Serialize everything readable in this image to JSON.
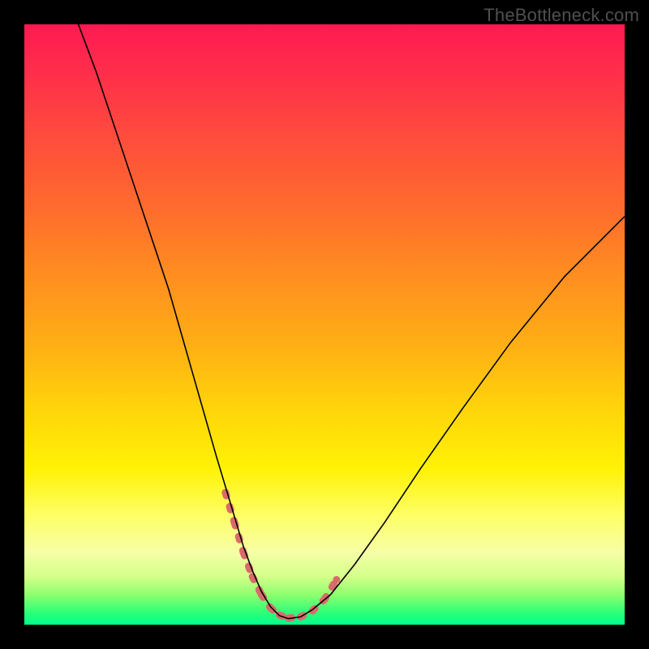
{
  "watermark": "TheBottleneck.com",
  "chart_data": {
    "type": "line",
    "title": "",
    "xlabel": "",
    "ylabel": "",
    "xlim": [
      0,
      100
    ],
    "ylim": [
      0,
      100
    ],
    "grid": false,
    "series": [
      {
        "name": "bottleneck-curve",
        "x": [
          9,
          12,
          15,
          18,
          21,
          24,
          26,
          28,
          30,
          32,
          33.5,
          35,
          36.5,
          38,
          39.5,
          41,
          42.5,
          44,
          46,
          48,
          51,
          55,
          60,
          66,
          73,
          81,
          90,
          100
        ],
        "y": [
          100,
          92,
          83,
          74,
          65,
          56,
          49,
          42,
          35,
          28,
          23,
          18,
          13,
          9,
          5.5,
          3,
          1.5,
          1,
          1.3,
          2.5,
          5,
          10,
          17,
          26,
          36,
          47,
          58,
          68
        ],
        "color": "#000000",
        "width": 1.6
      },
      {
        "name": "optimal-zone-marker",
        "x": [
          33.5,
          35,
          36.5,
          38,
          39.5,
          41,
          42.5,
          44,
          46,
          48,
          50,
          52
        ],
        "y": [
          22,
          17,
          12,
          8,
          5,
          2.8,
          1.6,
          1.1,
          1.3,
          2.3,
          4.2,
          7.5
        ],
        "color": "#d96b6b",
        "width": 9,
        "dotted": true
      }
    ],
    "background_gradient_stops": [
      {
        "pos": 0,
        "color": "#ff1a52"
      },
      {
        "pos": 18,
        "color": "#ff4a3e"
      },
      {
        "pos": 42,
        "color": "#ff8e20"
      },
      {
        "pos": 64,
        "color": "#ffd40a"
      },
      {
        "pos": 82,
        "color": "#feff68"
      },
      {
        "pos": 95,
        "color": "#8eff6e"
      },
      {
        "pos": 100,
        "color": "#00ff8a"
      }
    ]
  }
}
